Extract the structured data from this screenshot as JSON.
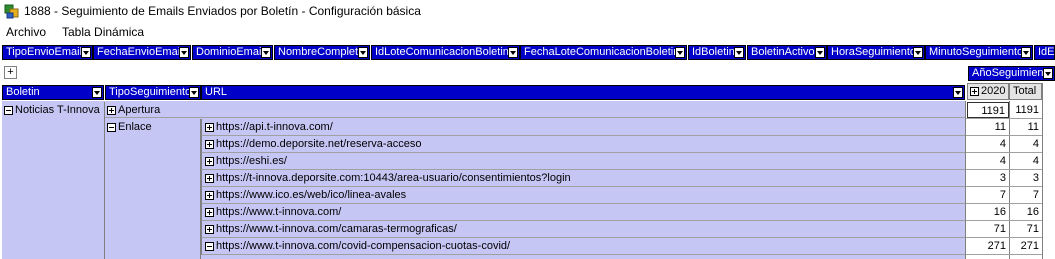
{
  "window": {
    "title": "1888 - Seguimiento de Emails Enviados por Boletín - Configuración básica"
  },
  "menu": [
    "Archivo",
    "Tabla Dinámica"
  ],
  "filters": [
    "TipoEnvioEmail",
    "FechaEnvioEmail",
    "DominioEmail",
    "NombreCompleto",
    "IdLoteComunicacionBoletin",
    "FechaLoteComunicacionBoletin",
    "IdBoletin",
    "BoletinActivo",
    "HoraSeguimiento",
    "MinutoSeguimiento",
    "IdE"
  ],
  "expand_all_label": "+",
  "column_field": "AñoSeguimiento",
  "row_fields": [
    "Boletin",
    "TipoSeguimiento",
    "URL"
  ],
  "col_headers": {
    "year": "2020",
    "total": "Total"
  },
  "rows": {
    "boletin": "Noticias T-Innova",
    "apertura": {
      "label": "Apertura",
      "y2020": "1191",
      "total": "1191"
    },
    "enlace": "Enlace",
    "urls": [
      {
        "url": "https://api.t-innova.com/",
        "y2020": "11",
        "total": "11"
      },
      {
        "url": "https://demo.deporsite.net/reserva-acceso",
        "y2020": "4",
        "total": "4"
      },
      {
        "url": "https://eshi.es/",
        "y2020": "4",
        "total": "4"
      },
      {
        "url": "https://t-innova.deporsite.com:10443/area-usuario/consentimientos?login",
        "y2020": "3",
        "total": "3"
      },
      {
        "url": "https://www.ico.es/web/ico/linea-avales",
        "y2020": "7",
        "total": "7"
      },
      {
        "url": "https://www.t-innova.com/",
        "y2020": "16",
        "total": "16"
      },
      {
        "url": "https://www.t-innova.com/camaras-termograficas/",
        "y2020": "71",
        "total": "71"
      },
      {
        "url": "https://www.t-innova.com/covid-compensacion-cuotas-covid/",
        "y2020": "271",
        "total": "271"
      }
    ]
  },
  "colors": {
    "header_blue": "#0000c8",
    "row_lavender": "#c6c6f5"
  }
}
